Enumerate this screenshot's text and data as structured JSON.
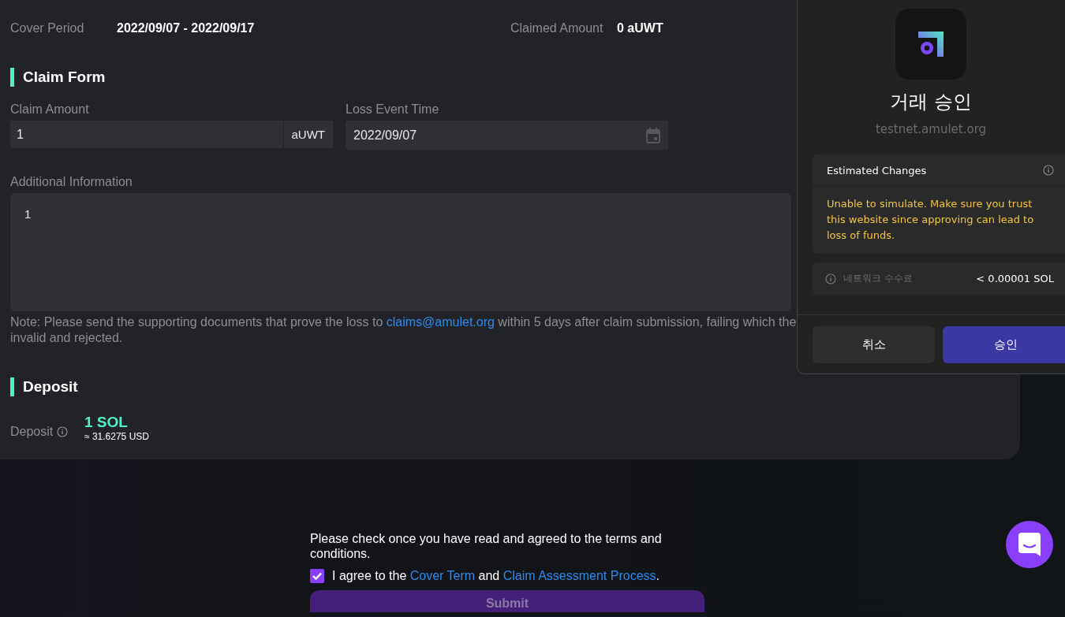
{
  "cover_summary": [
    {
      "label": "Cover Period",
      "value": "2022/09/07 - 2022/09/17"
    },
    {
      "label": "Claimed Amount",
      "value": "0 aUWT"
    }
  ],
  "claim_form": {
    "title": "Claim Form",
    "claim_amount": {
      "label": "Claim Amount",
      "value": "1",
      "unit": "aUWT"
    },
    "loss_event_time": {
      "label": "Loss Event Time",
      "value": "2022/09/07"
    },
    "additional_information": {
      "label": "Additional Information",
      "value": "1"
    },
    "note": {
      "text": "Note: Please send the supporting documents that prove the loss to",
      "link": "claims@amulet.org",
      "text_after": "within 5 days after claim submission, failing which the",
      "text_line_2": "invalid and rejected."
    }
  },
  "deposit": {
    "title": "Deposit",
    "label": "Deposit",
    "amount": "1 SOL",
    "usd": "≈ 31.6275 USD"
  },
  "agreement": {
    "prompt": "Please check once you have read and agreed to the terms and conditions.",
    "checked": true,
    "text_before": "I agree to the",
    "link_1": "Cover Term",
    "text_middle": "and",
    "link_2": "Claim Assessment Process",
    "text_after": "."
  },
  "submit_button": {
    "label": "Submit",
    "disabled": true
  },
  "wallet_popup": {
    "title": "거래 승인",
    "origin": "testnet.amulet.org",
    "estimated_changes": {
      "title": "Estimated Changes",
      "warning": "Unable to simulate. Make sure you trust this website since approving can lead to loss of funds."
    },
    "network_fee": {
      "label": "네트워크 수수료",
      "value": "< 0.00001 SOL"
    },
    "buttons": [
      {
        "label": "취소",
        "kind": "secondary"
      },
      {
        "label": "승인",
        "kind": "primary"
      }
    ]
  }
}
